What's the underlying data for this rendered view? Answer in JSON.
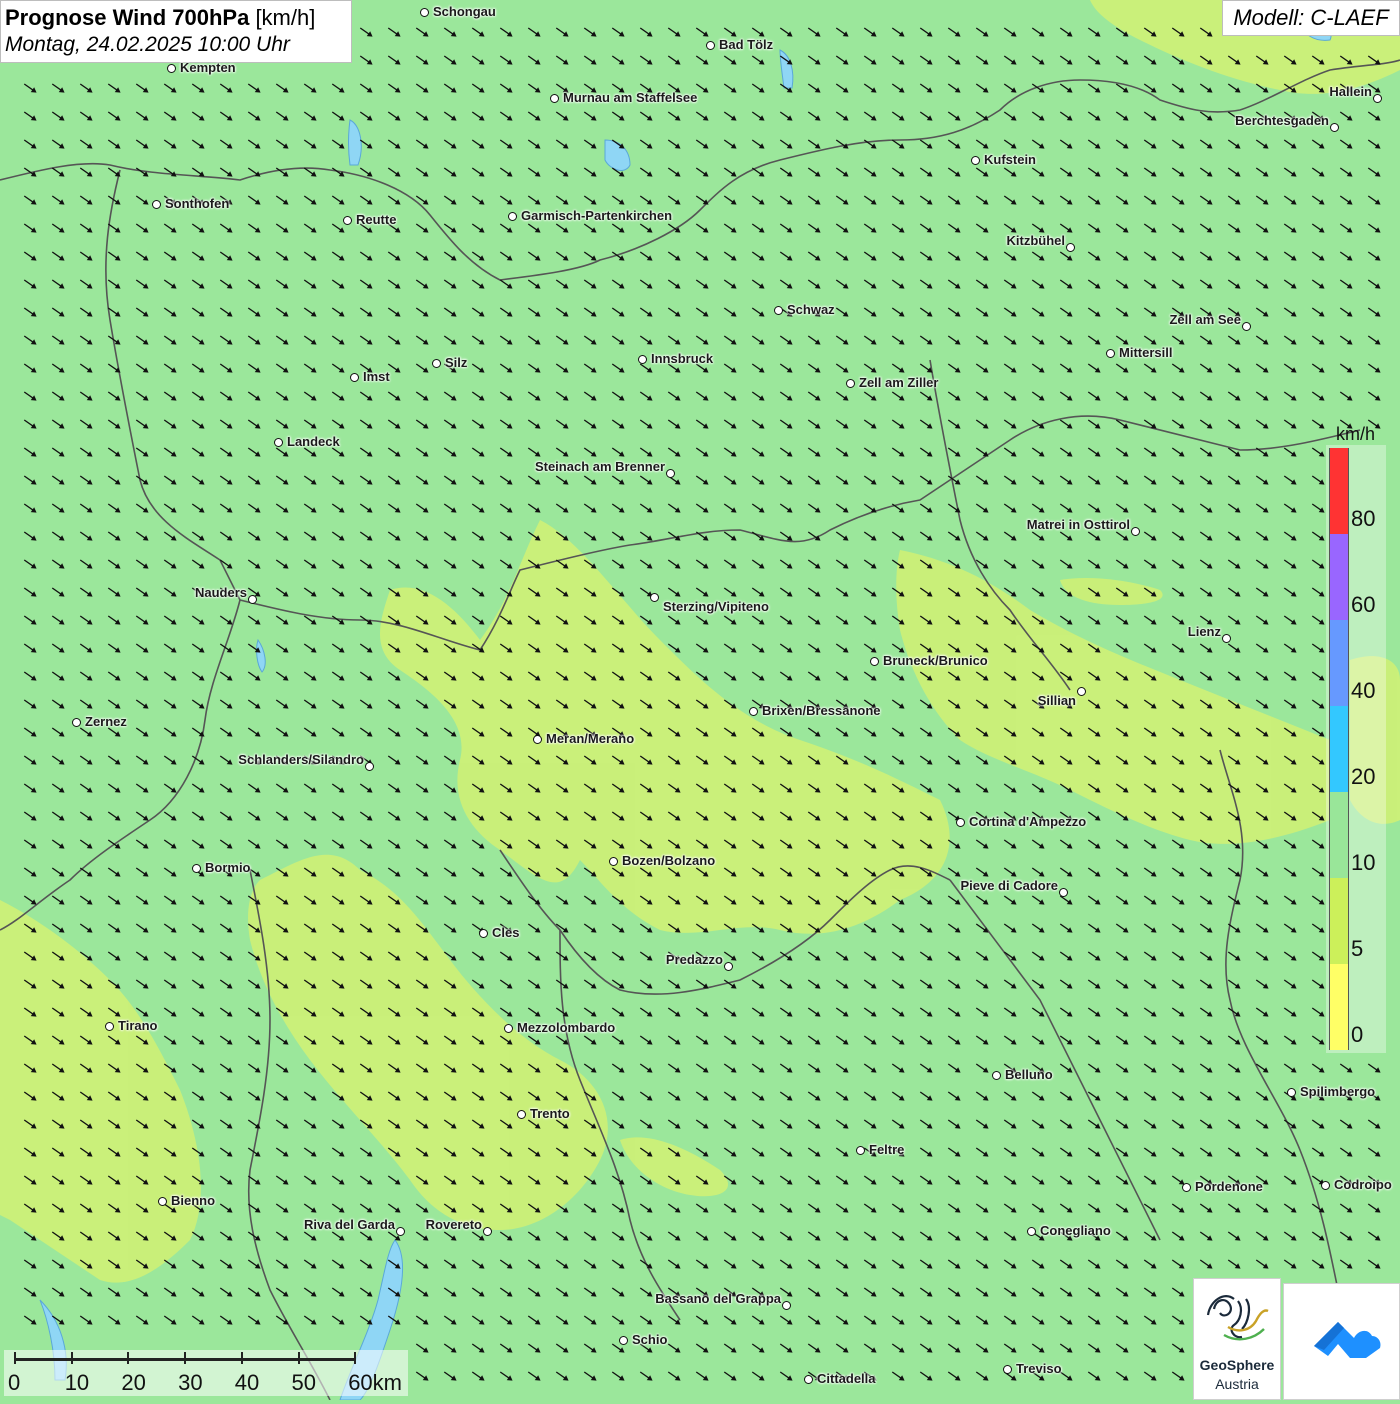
{
  "header": {
    "title_bold": "Prognose Wind 700hPa",
    "title_unit": "[km/h]",
    "subtitle": "Montag, 24.02.2025 10:00 Uhr",
    "model": "Modell: C-LAEF"
  },
  "legend": {
    "unit": "km/h",
    "stops": [
      {
        "value": "0",
        "color": "#ffff66"
      },
      {
        "value": "5",
        "color": "#ccf05a"
      },
      {
        "value": "10",
        "color": "#99e699"
      },
      {
        "value": "20",
        "color": "#33c8ff"
      },
      {
        "value": "40",
        "color": "#6699ff"
      },
      {
        "value": "60",
        "color": "#9966ff"
      },
      {
        "value": "80",
        "color": "#ff3333"
      }
    ]
  },
  "scale_bar": {
    "labels": [
      "0",
      "10",
      "20",
      "30",
      "40",
      "50",
      "60km"
    ]
  },
  "logos": {
    "geosphere_line1": "GeoSphere",
    "geosphere_line2": "Austria"
  },
  "colors": {
    "background_wind": "#9be79b",
    "weak_wind_zone": "#ccf078",
    "border_line": "#555555",
    "lake": "#8fd6f5"
  },
  "wind_field": {
    "predominant_direction": "northwest",
    "arrow_color": "#111111"
  },
  "cities": [
    {
      "name": "Schongau"
    },
    {
      "name": "Bad Tölz"
    },
    {
      "name": "Kempten"
    },
    {
      "name": "Murnau am Staffelsee"
    },
    {
      "name": "Hallein"
    },
    {
      "name": "Berchtesgaden"
    },
    {
      "name": "Kufstein"
    },
    {
      "name": "Sonthofen"
    },
    {
      "name": "Reutte"
    },
    {
      "name": "Garmisch-Partenkirchen"
    },
    {
      "name": "Kitzbühel"
    },
    {
      "name": "Schwaz"
    },
    {
      "name": "Zell am See"
    },
    {
      "name": "Innsbruck"
    },
    {
      "name": "Silz"
    },
    {
      "name": "Imst"
    },
    {
      "name": "Mittersill"
    },
    {
      "name": "Zell am Ziller"
    },
    {
      "name": "Landeck"
    },
    {
      "name": "Steinach am Brenner"
    },
    {
      "name": "Matrei in Osttirol"
    },
    {
      "name": "Nauders"
    },
    {
      "name": "Sterzing/Vipiteno"
    },
    {
      "name": "Lienz"
    },
    {
      "name": "Bruneck/Brunico"
    },
    {
      "name": "Sillian"
    },
    {
      "name": "Brixen/Bressanone"
    },
    {
      "name": "Zernez"
    },
    {
      "name": "Meran/Merano"
    },
    {
      "name": "Schlanders/Silandro"
    },
    {
      "name": "Cortina d'Ampezzo"
    },
    {
      "name": "Bozen/Bolzano"
    },
    {
      "name": "Bormio"
    },
    {
      "name": "Pieve di Cadore"
    },
    {
      "name": "Cles"
    },
    {
      "name": "Predazzo"
    },
    {
      "name": "Tirano"
    },
    {
      "name": "Mezzolombardo"
    },
    {
      "name": "Belluno"
    },
    {
      "name": "Spilimbergo"
    },
    {
      "name": "Trento"
    },
    {
      "name": "Feltre"
    },
    {
      "name": "Pordenone"
    },
    {
      "name": "Codroipo"
    },
    {
      "name": "Bienno"
    },
    {
      "name": "Riva del Garda"
    },
    {
      "name": "Rovereto"
    },
    {
      "name": "Conegliano"
    },
    {
      "name": "Bassano del Grappa"
    },
    {
      "name": "Schio"
    },
    {
      "name": "Treviso"
    },
    {
      "name": "Cittadella"
    }
  ]
}
